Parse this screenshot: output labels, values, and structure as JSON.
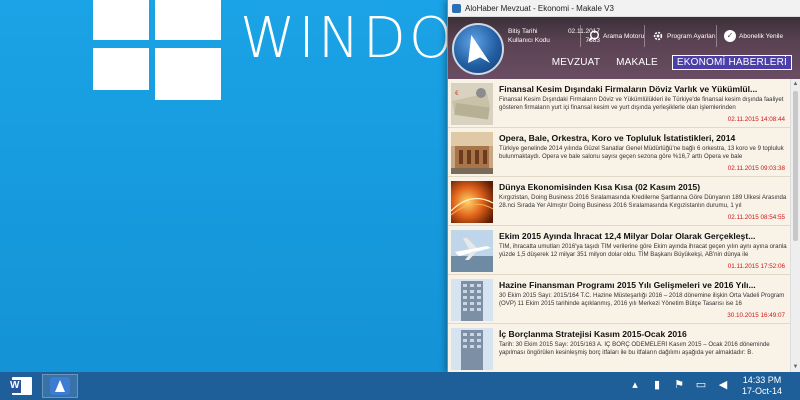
{
  "desktop": {
    "wordmark": "WINDOWS"
  },
  "window": {
    "title": "AloHaber Mevzuat - Ekonomi - Makale V3"
  },
  "header": {
    "info": [
      {
        "label": "Bitiş Tarihi",
        "value": "02.11.2017"
      },
      {
        "label": "Kullanıcı Kodu",
        "value": "7683"
      }
    ],
    "buttons": {
      "search": "Arama Motoru",
      "settings": "Program Ayarları",
      "renew": "Abonelik Yenile"
    },
    "tabs": [
      "MEVZUAT",
      "MAKALE",
      "EKONOMİ HABERLERİ"
    ]
  },
  "articles": [
    {
      "title": "Finansal Kesim Dışındaki Firmaların Döviz Varlık ve Yükümlül...",
      "desc": "Finansal Kesim Dışındaki Firmaların Döviz ve Yükümlülükleri ile Türkiye'de finansal kesim dışında faaliyet gösteren firmaların yurt içi finansal kesim ve yurt dışında yerleşiklerle olan işlemlerinden",
      "date": "02.11.2015 14:08:44",
      "thumb": "money-thumb"
    },
    {
      "title": "Opera, Bale, Orkestra, Koro ve Topluluk İstatistikleri, 2014",
      "desc": "Türkiye genelinde 2014 yılında Güzel Sanatlar Genel Müdürlüğü'ne bağlı 6 orkestra, 13 koro ve 9 topluluk bulunmaktaydı. Opera ve bale salonu sayısı geçen sezona göre %16,7 arttı Opera ve bale",
      "date": "02.11.2015 09:03:38",
      "thumb": "building-thumb"
    },
    {
      "title": "Dünya Ekonomisinden Kısa Kısa (02 Kasım 2015)",
      "desc": "Kırgızistan, Doing Business 2016 Sıralamasında Kredilerne Şartlarına Göre Dünyanın 189 Ülkesi Arasında 28.nci Sırada Yer Almıştır Doing Business 2016 Sıralamasında Kırgızistanlın durumu, 1 yıl",
      "date": "02.11.2015 08:54:55",
      "thumb": "abstract-thumb"
    },
    {
      "title": "Ekim 2015 Ayında İhracat 12,4 Milyar Dolar Olarak Gerçekleşt...",
      "desc": "TİM, ihracatta umutları 2016'ya taşıdı TİM verilerine göre Ekim ayında ihracat geçen yılın aynı ayına oranla yüzde 1,5 düşerek 12 milyar 351 milyon dolar oldu. TİM Başkanı Büyükekşi, AB'nin dünya ile",
      "date": "01.11.2015 17:52:06",
      "thumb": "plane-thumb"
    },
    {
      "title": "Hazine Finansman Programı 2015 Yılı Gelişmeleri ve 2016 Yılı...",
      "desc": "30 Ekim 2015 Sayı: 2015/164 T.C. Hazine Müsteşarlığı 2016 – 2018 dönemine ilişkin Orta Vadeli Program (OVP) 11 Ekim 2015 tarihinde açıklanmış, 2016 yılı Merkezi Yönetim Bütçe Tasarısı ise 16",
      "date": "30.10.2015 16:49:07",
      "thumb": "tower-thumb"
    },
    {
      "title": "İç Borçlanma Stratejisi Kasım 2015-Ocak 2016",
      "desc": "Tarih: 30 Ekim 2015 Sayı: 2015/163 A. İÇ BORÇ ÖDEMELERİ Kasım 2015 – Ocak 2016 döneminde yapılması öngörülen kesinleşmiş borç itfaları ile bu itfaların dağılımı aşağıda yer almaktadır: B.",
      "date": "",
      "thumb": "tower-thumb"
    }
  ],
  "taskbar": {
    "time": "14:33 PM",
    "date": "17-Oct-14"
  }
}
